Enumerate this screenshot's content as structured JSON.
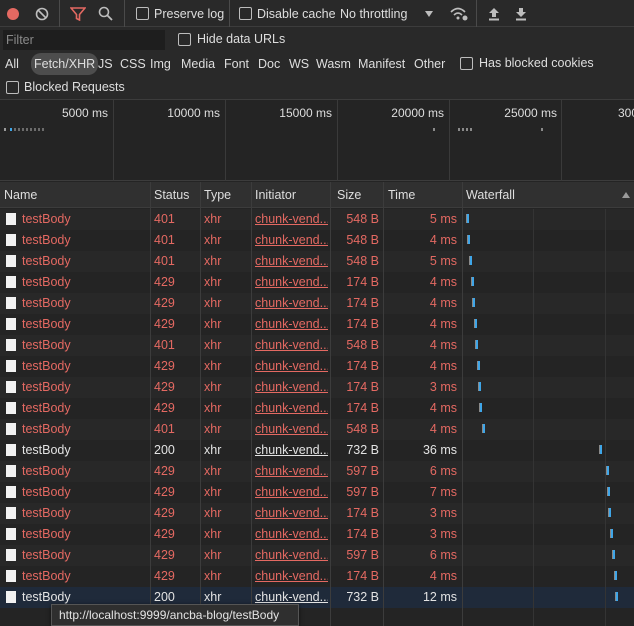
{
  "toolbar": {
    "preserve_log": "Preserve log",
    "disable_cache": "Disable cache",
    "throttling": "No throttling"
  },
  "filter": {
    "placeholder": "Filter",
    "hide_data_urls": "Hide data URLs",
    "types": [
      "All",
      "Fetch/XHR",
      "JS",
      "CSS",
      "Img",
      "Media",
      "Font",
      "Doc",
      "WS",
      "Wasm",
      "Manifest",
      "Other"
    ],
    "active_type": "Fetch/XHR",
    "has_blocked_cookies": "Has blocked cookies",
    "blocked_requests": "Blocked Requests"
  },
  "overview": {
    "ticks": [
      "5000 ms",
      "10000 ms",
      "15000 ms",
      "20000 ms",
      "25000 ms",
      "300"
    ]
  },
  "columns": {
    "name": "Name",
    "status": "Status",
    "type": "Type",
    "initiator": "Initiator",
    "size": "Size",
    "time": "Time",
    "waterfall": "Waterfall"
  },
  "requests": [
    {
      "name": "testBody",
      "status": "401",
      "type": "xhr",
      "initiator": "chunk-vend...",
      "size": "548 B",
      "time": "5 ms",
      "error": true
    },
    {
      "name": "testBody",
      "status": "401",
      "type": "xhr",
      "initiator": "chunk-vend...",
      "size": "548 B",
      "time": "4 ms",
      "error": true
    },
    {
      "name": "testBody",
      "status": "401",
      "type": "xhr",
      "initiator": "chunk-vend...",
      "size": "548 B",
      "time": "5 ms",
      "error": true
    },
    {
      "name": "testBody",
      "status": "429",
      "type": "xhr",
      "initiator": "chunk-vend...",
      "size": "174 B",
      "time": "4 ms",
      "error": true
    },
    {
      "name": "testBody",
      "status": "429",
      "type": "xhr",
      "initiator": "chunk-vend...",
      "size": "174 B",
      "time": "4 ms",
      "error": true
    },
    {
      "name": "testBody",
      "status": "429",
      "type": "xhr",
      "initiator": "chunk-vend...",
      "size": "174 B",
      "time": "4 ms",
      "error": true
    },
    {
      "name": "testBody",
      "status": "401",
      "type": "xhr",
      "initiator": "chunk-vend...",
      "size": "548 B",
      "time": "4 ms",
      "error": true
    },
    {
      "name": "testBody",
      "status": "429",
      "type": "xhr",
      "initiator": "chunk-vend...",
      "size": "174 B",
      "time": "4 ms",
      "error": true
    },
    {
      "name": "testBody",
      "status": "429",
      "type": "xhr",
      "initiator": "chunk-vend...",
      "size": "174 B",
      "time": "3 ms",
      "error": true
    },
    {
      "name": "testBody",
      "status": "429",
      "type": "xhr",
      "initiator": "chunk-vend...",
      "size": "174 B",
      "time": "4 ms",
      "error": true
    },
    {
      "name": "testBody",
      "status": "401",
      "type": "xhr",
      "initiator": "chunk-vend...",
      "size": "548 B",
      "time": "4 ms",
      "error": true
    },
    {
      "name": "testBody",
      "status": "200",
      "type": "xhr",
      "initiator": "chunk-vend...",
      "size": "732 B",
      "time": "36 ms",
      "error": false
    },
    {
      "name": "testBody",
      "status": "429",
      "type": "xhr",
      "initiator": "chunk-vend...",
      "size": "597 B",
      "time": "6 ms",
      "error": true
    },
    {
      "name": "testBody",
      "status": "429",
      "type": "xhr",
      "initiator": "chunk-vend...",
      "size": "597 B",
      "time": "7 ms",
      "error": true
    },
    {
      "name": "testBody",
      "status": "429",
      "type": "xhr",
      "initiator": "chunk-vend...",
      "size": "174 B",
      "time": "3 ms",
      "error": true
    },
    {
      "name": "testBody",
      "status": "429",
      "type": "xhr",
      "initiator": "chunk-vend...",
      "size": "174 B",
      "time": "3 ms",
      "error": true
    },
    {
      "name": "testBody",
      "status": "429",
      "type": "xhr",
      "initiator": "chunk-vend...",
      "size": "597 B",
      "time": "6 ms",
      "error": true
    },
    {
      "name": "testBody",
      "status": "429",
      "type": "xhr",
      "initiator": "chunk-vend...",
      "size": "174 B",
      "time": "4 ms",
      "error": true
    },
    {
      "name": "testBody",
      "status": "200",
      "type": "xhr",
      "initiator": "chunk-vend...",
      "size": "732 B",
      "time": "12 ms",
      "error": false
    }
  ],
  "tooltip": "http://localhost:9999/ancba-blog/testBody"
}
